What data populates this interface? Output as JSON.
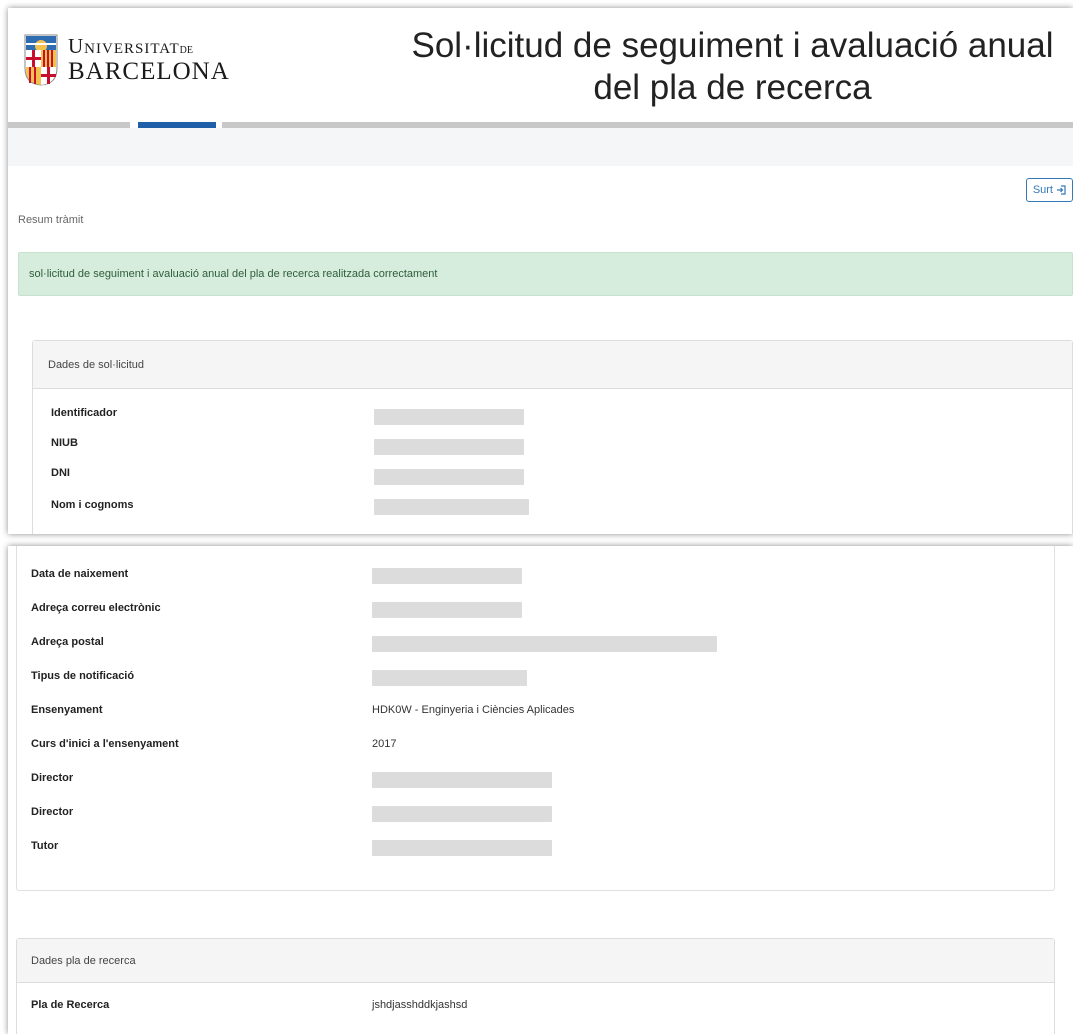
{
  "header": {
    "logo_line1": "Universitat",
    "logo_de": "DE",
    "logo_line2": "BARCELONA",
    "title_line1": "Sol·licitud de seguiment i avaluació anual",
    "title_line2": "del pla de recerca"
  },
  "actions": {
    "exit_label": "Surt"
  },
  "breadcrumb": "Resum tràmit",
  "alert": {
    "message": "sol·licitud de seguiment i avaluació anual del pla de recerca realitzada correctament"
  },
  "colors": {
    "accent": "#1f5fa8",
    "alert_bg": "#d6ecdc",
    "link": "#337ab7"
  },
  "dades_solicitud": {
    "heading": "Dades de sol·licitud",
    "fields": [
      {
        "label": "Identificador",
        "value": ""
      },
      {
        "label": "NIUB",
        "value": ""
      },
      {
        "label": "DNI",
        "value": ""
      },
      {
        "label": "Nom i cognoms",
        "value": ""
      },
      {
        "label": "Data de naixement",
        "value": ""
      },
      {
        "label": "Adreça correu electrònic",
        "value": ""
      },
      {
        "label": "Adreça postal",
        "value": ""
      },
      {
        "label": "Tipus de notificació",
        "value": ""
      },
      {
        "label": "Ensenyament",
        "value": "HDK0W - Enginyeria i Ciències Aplicades"
      },
      {
        "label": "Curs d'inici a l'ensenyament",
        "value": "2017"
      },
      {
        "label": "Director",
        "value": ""
      },
      {
        "label": "Director",
        "value": ""
      },
      {
        "label": "Tutor",
        "value": ""
      }
    ]
  },
  "dades_pla": {
    "heading": "Dades pla de recerca",
    "fields": [
      {
        "label": "Pla de Recerca",
        "value": "jshdjasshddkjashsd"
      }
    ]
  }
}
